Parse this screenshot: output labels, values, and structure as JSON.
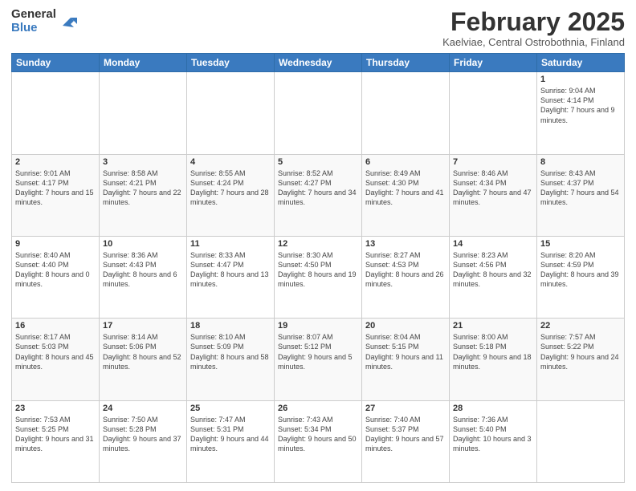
{
  "logo": {
    "general": "General",
    "blue": "Blue"
  },
  "header": {
    "title": "February 2025",
    "subtitle": "Kaelviae, Central Ostrobothnia, Finland"
  },
  "days_of_week": [
    "Sunday",
    "Monday",
    "Tuesday",
    "Wednesday",
    "Thursday",
    "Friday",
    "Saturday"
  ],
  "weeks": [
    [
      {
        "day": "",
        "info": ""
      },
      {
        "day": "",
        "info": ""
      },
      {
        "day": "",
        "info": ""
      },
      {
        "day": "",
        "info": ""
      },
      {
        "day": "",
        "info": ""
      },
      {
        "day": "",
        "info": ""
      },
      {
        "day": "1",
        "info": "Sunrise: 9:04 AM\nSunset: 4:14 PM\nDaylight: 7 hours and 9 minutes."
      }
    ],
    [
      {
        "day": "2",
        "info": "Sunrise: 9:01 AM\nSunset: 4:17 PM\nDaylight: 7 hours and 15 minutes."
      },
      {
        "day": "3",
        "info": "Sunrise: 8:58 AM\nSunset: 4:21 PM\nDaylight: 7 hours and 22 minutes."
      },
      {
        "day": "4",
        "info": "Sunrise: 8:55 AM\nSunset: 4:24 PM\nDaylight: 7 hours and 28 minutes."
      },
      {
        "day": "5",
        "info": "Sunrise: 8:52 AM\nSunset: 4:27 PM\nDaylight: 7 hours and 34 minutes."
      },
      {
        "day": "6",
        "info": "Sunrise: 8:49 AM\nSunset: 4:30 PM\nDaylight: 7 hours and 41 minutes."
      },
      {
        "day": "7",
        "info": "Sunrise: 8:46 AM\nSunset: 4:34 PM\nDaylight: 7 hours and 47 minutes."
      },
      {
        "day": "8",
        "info": "Sunrise: 8:43 AM\nSunset: 4:37 PM\nDaylight: 7 hours and 54 minutes."
      }
    ],
    [
      {
        "day": "9",
        "info": "Sunrise: 8:40 AM\nSunset: 4:40 PM\nDaylight: 8 hours and 0 minutes."
      },
      {
        "day": "10",
        "info": "Sunrise: 8:36 AM\nSunset: 4:43 PM\nDaylight: 8 hours and 6 minutes."
      },
      {
        "day": "11",
        "info": "Sunrise: 8:33 AM\nSunset: 4:47 PM\nDaylight: 8 hours and 13 minutes."
      },
      {
        "day": "12",
        "info": "Sunrise: 8:30 AM\nSunset: 4:50 PM\nDaylight: 8 hours and 19 minutes."
      },
      {
        "day": "13",
        "info": "Sunrise: 8:27 AM\nSunset: 4:53 PM\nDaylight: 8 hours and 26 minutes."
      },
      {
        "day": "14",
        "info": "Sunrise: 8:23 AM\nSunset: 4:56 PM\nDaylight: 8 hours and 32 minutes."
      },
      {
        "day": "15",
        "info": "Sunrise: 8:20 AM\nSunset: 4:59 PM\nDaylight: 8 hours and 39 minutes."
      }
    ],
    [
      {
        "day": "16",
        "info": "Sunrise: 8:17 AM\nSunset: 5:03 PM\nDaylight: 8 hours and 45 minutes."
      },
      {
        "day": "17",
        "info": "Sunrise: 8:14 AM\nSunset: 5:06 PM\nDaylight: 8 hours and 52 minutes."
      },
      {
        "day": "18",
        "info": "Sunrise: 8:10 AM\nSunset: 5:09 PM\nDaylight: 8 hours and 58 minutes."
      },
      {
        "day": "19",
        "info": "Sunrise: 8:07 AM\nSunset: 5:12 PM\nDaylight: 9 hours and 5 minutes."
      },
      {
        "day": "20",
        "info": "Sunrise: 8:04 AM\nSunset: 5:15 PM\nDaylight: 9 hours and 11 minutes."
      },
      {
        "day": "21",
        "info": "Sunrise: 8:00 AM\nSunset: 5:18 PM\nDaylight: 9 hours and 18 minutes."
      },
      {
        "day": "22",
        "info": "Sunrise: 7:57 AM\nSunset: 5:22 PM\nDaylight: 9 hours and 24 minutes."
      }
    ],
    [
      {
        "day": "23",
        "info": "Sunrise: 7:53 AM\nSunset: 5:25 PM\nDaylight: 9 hours and 31 minutes."
      },
      {
        "day": "24",
        "info": "Sunrise: 7:50 AM\nSunset: 5:28 PM\nDaylight: 9 hours and 37 minutes."
      },
      {
        "day": "25",
        "info": "Sunrise: 7:47 AM\nSunset: 5:31 PM\nDaylight: 9 hours and 44 minutes."
      },
      {
        "day": "26",
        "info": "Sunrise: 7:43 AM\nSunset: 5:34 PM\nDaylight: 9 hours and 50 minutes."
      },
      {
        "day": "27",
        "info": "Sunrise: 7:40 AM\nSunset: 5:37 PM\nDaylight: 9 hours and 57 minutes."
      },
      {
        "day": "28",
        "info": "Sunrise: 7:36 AM\nSunset: 5:40 PM\nDaylight: 10 hours and 3 minutes."
      },
      {
        "day": "",
        "info": ""
      }
    ]
  ]
}
